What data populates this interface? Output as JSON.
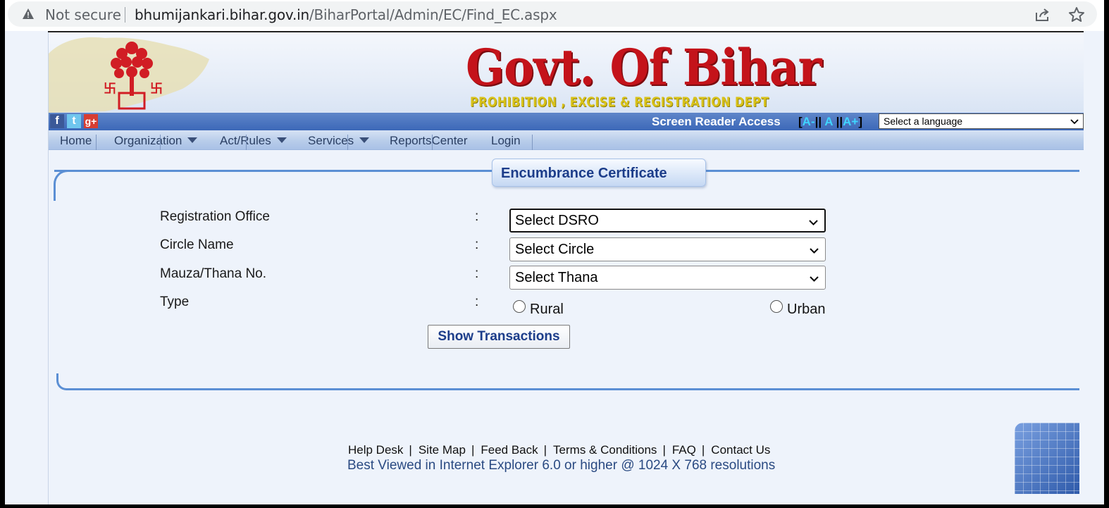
{
  "browser": {
    "security_label": "Not secure",
    "url_host": "bhumijankari.bihar.gov.in",
    "url_path": "/BiharPortal/Admin/EC/Find_EC.aspx"
  },
  "header": {
    "title": "Govt. Of Bihar",
    "subtitle": "PROHIBITION , EXCISE & REGISTRATION DEPT"
  },
  "accessibility": {
    "screen_reader": "Screen Reader Access",
    "open_bracket": "[",
    "font_small": "A-",
    "sep1": "||",
    "font_normal": "A",
    "sep2": "||",
    "font_large": "A+",
    "close_bracket": "]",
    "language_placeholder": "Select a language"
  },
  "social": {
    "facebook": "f",
    "twitter": "t",
    "googleplus": "g+"
  },
  "nav": {
    "home": "Home",
    "organization": "Organization",
    "act_rules": "Act/Rules",
    "services": "Services",
    "reports_center": "ReportsCenter",
    "login": "Login"
  },
  "form": {
    "title": "Encumbrance Certificate",
    "registration_office_label": "Registration Office",
    "circle_label": "Circle Name",
    "thana_label": "Mauza/Thana No.",
    "type_label": "Type",
    "colon": ":",
    "registration_office_value": "Select DSRO",
    "circle_value": "Select Circle",
    "thana_value": "Select Thana",
    "rural_label": "Rural",
    "urban_label": "Urban",
    "submit_label": "Show Transactions"
  },
  "footer": {
    "help_desk": "Help Desk",
    "site_map": "Site Map",
    "feed_back": "Feed Back",
    "terms": "Terms & Conditions",
    "faq": "FAQ",
    "contact": "Contact Us",
    "separator": "|",
    "note": "Best Viewed in Internet Explorer 6.0 or higher @ 1024 X 768 resolutions"
  },
  "colors": {
    "accent_blue": "#5b8fd4",
    "title_red": "#c4131a",
    "dept_yellow": "#d8c21a",
    "nav_text": "#2b3f63"
  }
}
